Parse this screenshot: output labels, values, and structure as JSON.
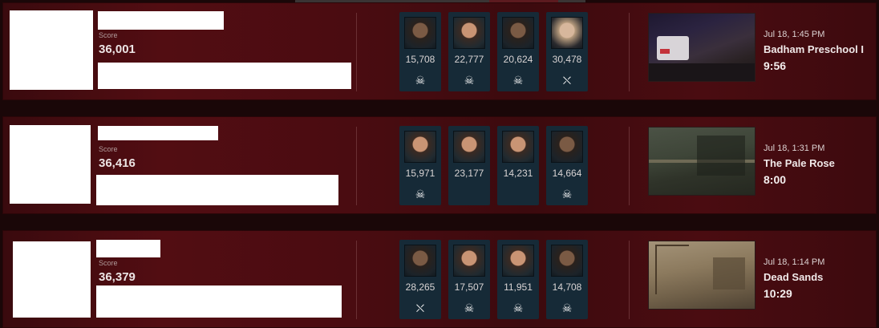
{
  "score_label": "Score",
  "matches": [
    {
      "score": "36,001",
      "survivors": [
        {
          "points": "15,708",
          "status_icon": "escaped-icon",
          "glyph": "☠"
        },
        {
          "points": "22,777",
          "status_icon": "escaped-icon",
          "glyph": "☠"
        },
        {
          "points": "20,624",
          "status_icon": "escaped-icon",
          "glyph": "☠"
        },
        {
          "points": "30,478",
          "status_icon": "hook-icon",
          "glyph": "⛌"
        }
      ],
      "date": "Jul 18, 1:45 PM",
      "map_name": "Badham Preschool I",
      "duration": "9:56"
    },
    {
      "score": "36,416",
      "survivors": [
        {
          "points": "15,971",
          "status_icon": "escaped-icon",
          "glyph": "☠"
        },
        {
          "points": "23,177",
          "status_icon": "",
          "glyph": ""
        },
        {
          "points": "14,231",
          "status_icon": "",
          "glyph": ""
        },
        {
          "points": "14,664",
          "status_icon": "escaped-icon",
          "glyph": "☠"
        }
      ],
      "date": "Jul 18, 1:31 PM",
      "map_name": "The Pale Rose",
      "duration": "8:00"
    },
    {
      "score": "36,379",
      "survivors": [
        {
          "points": "28,265",
          "status_icon": "hook-icon",
          "glyph": "⛌"
        },
        {
          "points": "17,507",
          "status_icon": "escaped-icon",
          "glyph": "☠"
        },
        {
          "points": "11,951",
          "status_icon": "escaped-icon",
          "glyph": "☠"
        },
        {
          "points": "14,708",
          "status_icon": "escaped-icon",
          "glyph": "☠"
        }
      ],
      "date": "Jul 18, 1:14 PM",
      "map_name": "Dead Sands",
      "duration": "10:29"
    }
  ]
}
